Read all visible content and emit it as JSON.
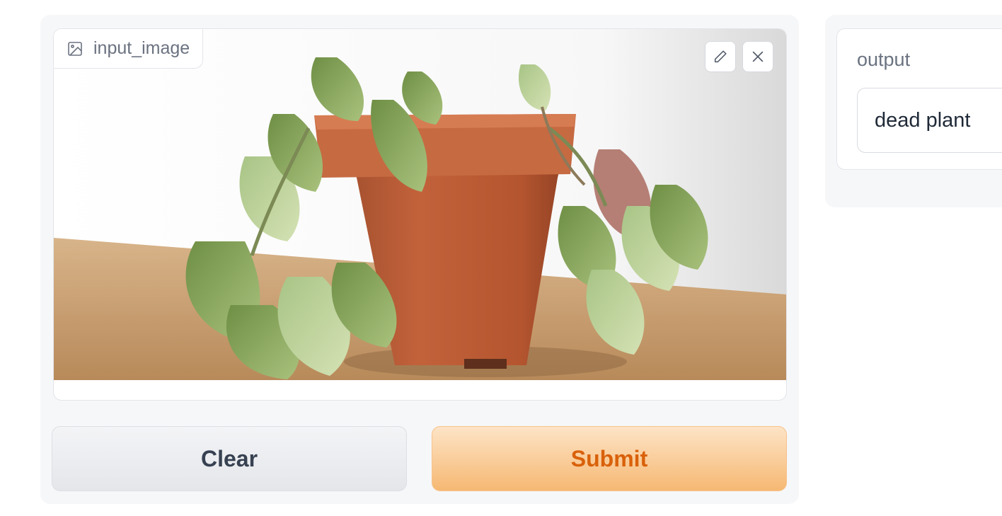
{
  "image_input": {
    "label": "input_image",
    "label_icon": "image-icon",
    "edit_icon": "pencil-icon",
    "close_icon": "close-icon",
    "image_subject": "wilted plant in terracotta pot"
  },
  "buttons": {
    "clear_label": "Clear",
    "submit_label": "Submit"
  },
  "output": {
    "label": "output",
    "value": "dead plant"
  },
  "colors": {
    "submit_text": "#d9610a",
    "submit_bg": "#f6b873",
    "panel_bg": "#f6f7f9"
  }
}
